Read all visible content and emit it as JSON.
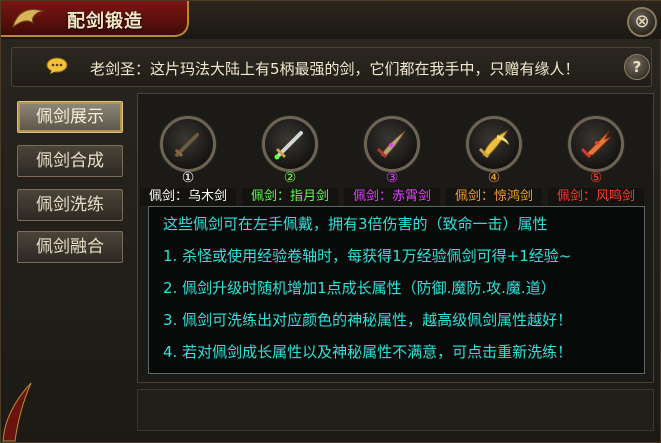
{
  "window": {
    "title": "配剑锻造",
    "close_label": "⊗"
  },
  "notice": {
    "text": "老剑圣：这片玛法大陆上有5柄最强的剑，它们都在我手中，只赠有缘人！",
    "help_label": "?"
  },
  "sidebar": {
    "items": [
      {
        "label": "佩剑展示",
        "active": true
      },
      {
        "label": "佩剑合成",
        "active": false
      },
      {
        "label": "佩剑洗练",
        "active": false
      },
      {
        "label": "佩剑融合",
        "active": false
      }
    ]
  },
  "swords": [
    {
      "number": "①",
      "name": "佩剑：乌木剑",
      "color": "#ffffff",
      "blade": "#6b5a44"
    },
    {
      "number": "②",
      "name": "佩剑：指月剑",
      "color": "#5cff4a",
      "blade": "#cfd6d8"
    },
    {
      "number": "③",
      "name": "佩剑：赤霄剑",
      "color": "#e040ff",
      "blade": "#b7a27a"
    },
    {
      "number": "④",
      "name": "佩剑：惊鸿剑",
      "color": "#f0a030",
      "blade": "#f2c040"
    },
    {
      "number": "⑤",
      "name": "佩剑：风鸣剑",
      "color": "#ff3a2a",
      "blade": "#e07a3a"
    }
  ],
  "info": {
    "lines": [
      "这些佩剑可在左手佩戴，拥有3倍伤害的（致命一击）属性",
      "1. 杀怪或使用经验卷轴时，每获得1万经验佩剑可得+1经验~",
      "2. 佩剑升级时随机增加1点成长属性（防御.魔防.攻.魔.道）",
      "3. 佩剑可洗练出对应颜色的神秘属性，越高级佩剑属性越好！",
      "4. 若对佩剑成长属性以及神秘属性不满意，可点击重新洗练！"
    ],
    "color": "#2fe0d6"
  }
}
